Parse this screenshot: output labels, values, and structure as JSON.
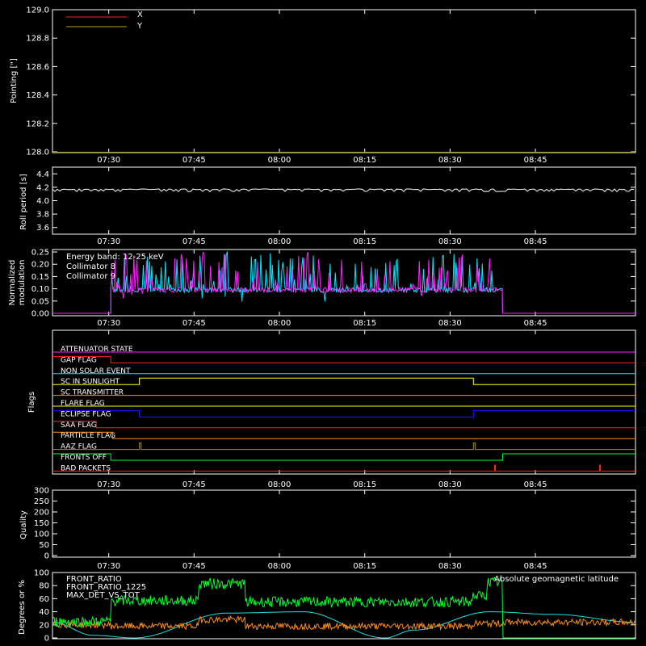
{
  "colors": {
    "background": "#000000",
    "axis": "#ffffff",
    "x_series": "#ff2020",
    "y_series": "#b0a020",
    "roll": "#ffffff",
    "coll8": "#00e8ff",
    "coll9": "#ff20ff",
    "front_ratio": "#ffff00",
    "front_ratio_1225": "#00ff30",
    "max_det": "#ff8c1a",
    "geomag": "#20e0e0"
  },
  "x_time_ticks": [
    "07:30",
    "07:45",
    "08:00",
    "08:15",
    "08:30",
    "08:45"
  ],
  "chart_data": [
    {
      "type": "line",
      "panel": "pointing",
      "ylabel": "Pointing [\"]",
      "ylim": [
        128.0,
        129.0
      ],
      "yticks": [
        "128.0",
        "128.2",
        "128.4",
        "128.6",
        "128.8",
        "129.0"
      ],
      "legend": [
        "X",
        "Y"
      ],
      "series": [
        {
          "name": "X",
          "values": []
        },
        {
          "name": "Y",
          "values": []
        }
      ]
    },
    {
      "type": "line",
      "panel": "roll",
      "ylabel": "Roll period [s]",
      "ylim": [
        3.5,
        4.5
      ],
      "yticks": [
        "3.6",
        "3.8",
        "4.0",
        "4.2",
        "4.4"
      ],
      "baseline": 4.17
    },
    {
      "type": "line",
      "panel": "modulation",
      "ylabel_lines": [
        "Normalized",
        "modulation"
      ],
      "ylim": [
        0,
        0.26
      ],
      "yticks": [
        "0.00",
        "0.05",
        "0.10",
        "0.15",
        "0.20",
        "0.25"
      ],
      "annotation": "Energy band: 12-25 keV",
      "legend": [
        "Collimator 8",
        "Collimator 9"
      ],
      "active_start": 0.1,
      "active_end": 0.772,
      "baseline": 0.095
    },
    {
      "type": "line",
      "panel": "flags",
      "ylabel": "Flags",
      "flags": [
        {
          "label": "ATTENUATOR STATE",
          "color": "#ff20ff",
          "steps": []
        },
        {
          "label": "GAP FLAG",
          "color": "#ff2020",
          "steps": [
            [
              0.0,
              1
            ],
            [
              0.1,
              0
            ]
          ]
        },
        {
          "label": "NON SOLAR EVENT",
          "color": "#20e0e0",
          "steps": []
        },
        {
          "label": "SC IN SUNLIGHT",
          "color": "#ffff00",
          "steps": [
            [
              0.0,
              0
            ],
            [
              0.149,
              1
            ],
            [
              0.722,
              0
            ]
          ]
        },
        {
          "label": "SC TRANSMITTER",
          "color": "#ff8c1a",
          "steps": []
        },
        {
          "label": "FLARE FLAG",
          "color": "#ffff00",
          "steps": []
        },
        {
          "label": "ECLIPSE FLAG",
          "color": "#1a1aff",
          "steps": [
            [
              0.0,
              1
            ],
            [
              0.149,
              0
            ],
            [
              0.722,
              1
            ]
          ]
        },
        {
          "label": "SAA FLAG",
          "color": "#ff2020",
          "steps": [
            [
              0.0,
              1
            ],
            [
              0.075,
              0
            ]
          ]
        },
        {
          "label": "PARTICLE FLAG",
          "color": "#ff8c1a",
          "steps": [
            [
              0.0,
              1
            ],
            [
              0.103,
              0
            ]
          ]
        },
        {
          "label": "AAZ FLAG",
          "color": "#a09020",
          "steps": [
            [
              0.0,
              0
            ],
            [
              0.149,
              1
            ],
            [
              0.152,
              0
            ],
            [
              0.722,
              1
            ],
            [
              0.725,
              0
            ]
          ]
        },
        {
          "label": "FRONTS OFF",
          "color": "#00ff30",
          "steps": [
            [
              0.0,
              1
            ],
            [
              0.1,
              0
            ],
            [
              0.772,
              1
            ]
          ]
        },
        {
          "label": "BAD PACKETS",
          "color": "#ff2020",
          "spikes": [
            0.759,
            0.939
          ]
        }
      ]
    },
    {
      "type": "line",
      "panel": "quality",
      "ylabel": "Quality",
      "ylim": [
        0,
        300
      ],
      "yticks": [
        "0",
        "50",
        "100",
        "150",
        "200",
        "250",
        "300"
      ]
    },
    {
      "type": "line",
      "panel": "ratio",
      "ylabel": "Degrees or %",
      "ylim": [
        0,
        100
      ],
      "yticks": [
        "0",
        "20",
        "40",
        "60",
        "80",
        "100"
      ],
      "legend": [
        "FRONT_RATIO",
        "FRONT_RATIO_1225",
        "MAX_DET_VS_TOT"
      ],
      "annotation": "Absolute geomagnetic latitude",
      "series": [
        {
          "name": "FRONT_RATIO_1225",
          "levels": [
            [
              0.0,
              25
            ],
            [
              0.1,
              57
            ],
            [
              0.25,
              83
            ],
            [
              0.33,
              55
            ],
            [
              0.72,
              64
            ],
            [
              0.745,
              85
            ],
            [
              0.772,
              0
            ]
          ]
        },
        {
          "name": "MAX_DET_VS_TOT",
          "levels": [
            [
              0.0,
              20
            ],
            [
              0.1,
              18
            ],
            [
              0.25,
              28
            ],
            [
              0.33,
              18
            ],
            [
              0.72,
              22
            ],
            [
              0.772,
              24
            ]
          ]
        },
        {
          "name": "Absolute geomagnetic latitude",
          "anchors": [
            [
              0.0,
              24
            ],
            [
              0.07,
              4
            ],
            [
              0.14,
              0
            ],
            [
              0.3,
              38
            ],
            [
              0.43,
              40
            ],
            [
              0.57,
              0
            ],
            [
              0.62,
              12
            ],
            [
              0.75,
              40
            ],
            [
              0.86,
              36
            ],
            [
              1.0,
              24
            ]
          ]
        }
      ]
    }
  ]
}
